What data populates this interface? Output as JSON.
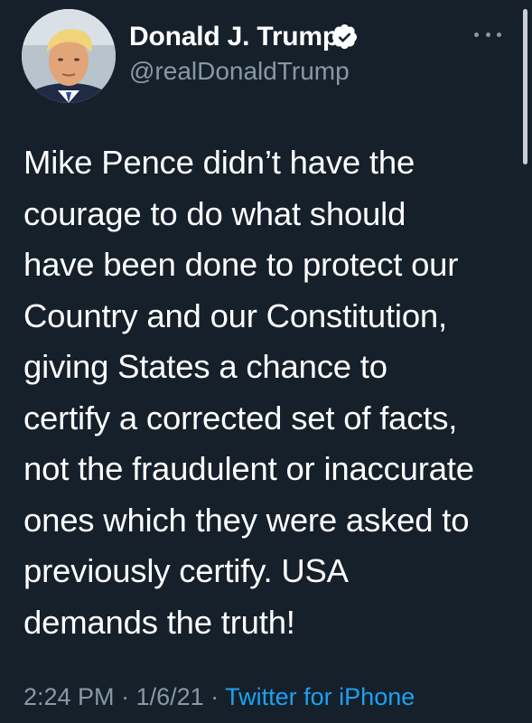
{
  "author": {
    "display_name": "Donald J. Trump",
    "handle": "@realDonaldTrump",
    "verified": true,
    "avatar_icon": "profile-photo"
  },
  "tweet": {
    "lines": [
      "Mike Pence didn’t have the",
      "courage to do what should",
      "have been done to protect our",
      "Country and our Constitution,",
      "giving States a chance to",
      "certify a corrected set of facts,",
      "not the fraudulent or inaccurate",
      "ones which they were asked to",
      "previously certify. USA",
      "demands the truth!"
    ]
  },
  "meta": {
    "time": "2:24 PM",
    "separator": " · ",
    "date": "1/6/21",
    "source": "Twitter for iPhone"
  },
  "colors": {
    "background": "#15202b",
    "text": "#ffffff",
    "secondary_text": "#8899a6",
    "link": "#1da1f2"
  }
}
